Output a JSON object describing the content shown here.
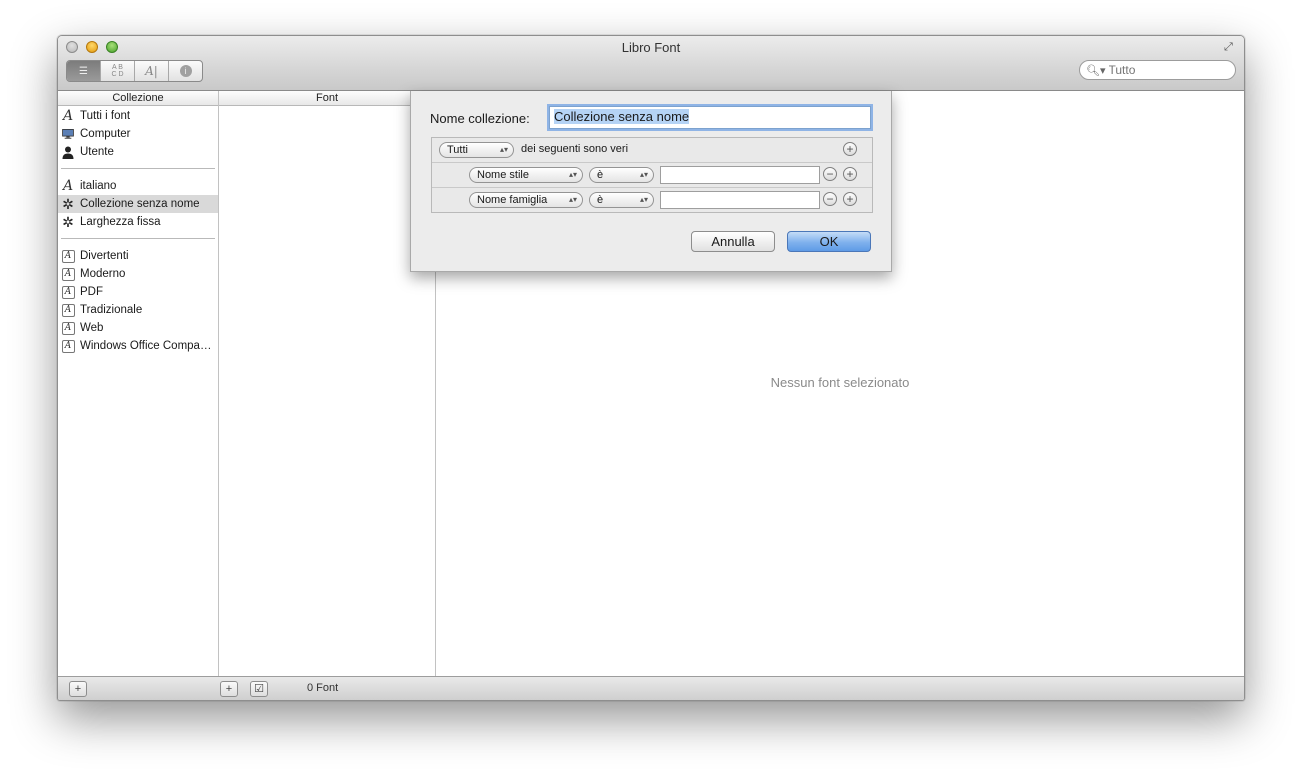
{
  "window": {
    "title": "Libro Font"
  },
  "toolbar": {
    "search_placeholder": "Tutto"
  },
  "columns": {
    "collections_header": "Collezione",
    "fonts_header": "Font"
  },
  "collections": {
    "group1": [
      "Tutti i font",
      "Computer",
      "Utente"
    ],
    "group2": [
      "italiano",
      "Collezione senza nome",
      "Larghezza fissa"
    ],
    "group3": [
      "Divertenti",
      "Moderno",
      "PDF",
      "Tradizionale",
      "Web",
      "Windows Office Compa…"
    ]
  },
  "main": {
    "empty_message": "Nessun font selezionato"
  },
  "status": {
    "font_count": "0 Font"
  },
  "dialog": {
    "name_label": "Nome collezione:",
    "name_value": "Collezione senza nome",
    "match_select": "Tutti",
    "match_text": "dei seguenti sono veri",
    "rules": [
      {
        "field": "Nome stile",
        "operator": "è",
        "value": ""
      },
      {
        "field": "Nome famiglia",
        "operator": "è",
        "value": ""
      }
    ],
    "cancel_label": "Annulla",
    "ok_label": "OK"
  }
}
